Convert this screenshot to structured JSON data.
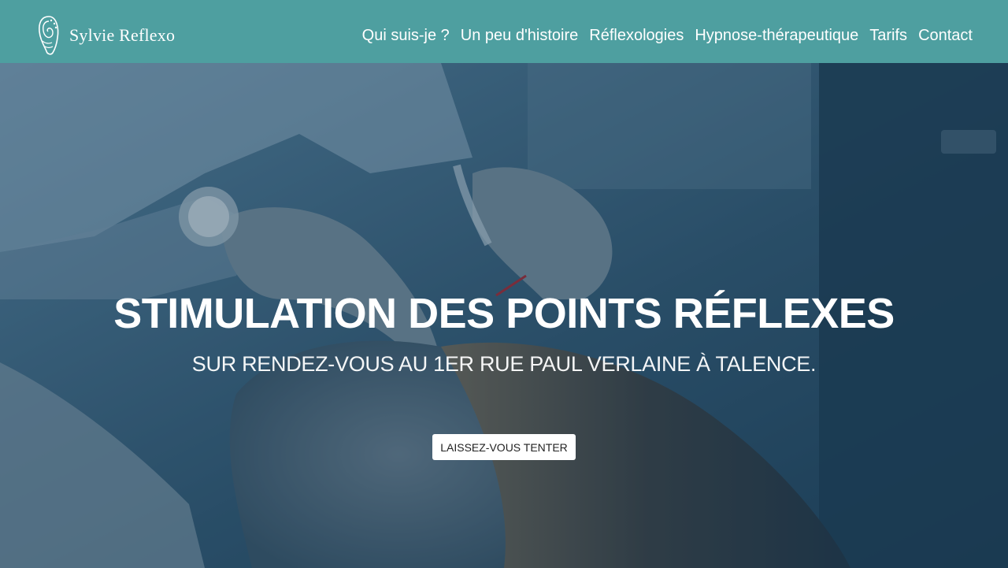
{
  "brand": {
    "name": "Sylvie Reflexo",
    "logo_icon": "ear-spiral-icon"
  },
  "nav": {
    "items": [
      {
        "label": "Qui suis-je ?"
      },
      {
        "label": "Un peu d'histoire"
      },
      {
        "label": "Réflexologies"
      },
      {
        "label": "Hypnose-thérapeutique"
      },
      {
        "label": "Tarifs"
      },
      {
        "label": "Contact"
      }
    ]
  },
  "hero": {
    "title": "STIMULATION DES POINTS RÉFLEXES",
    "subtitle": "SUR RENDEZ-VOUS AU 1ER RUE PAUL VERLAINE À TALENCE.",
    "cta_label": "LAISSEZ-VOUS TENTER"
  },
  "colors": {
    "header_bg": "#4e9fa0",
    "hero_overlay": "#2b4f66",
    "text": "#ffffff",
    "button_bg": "#ffffff"
  }
}
